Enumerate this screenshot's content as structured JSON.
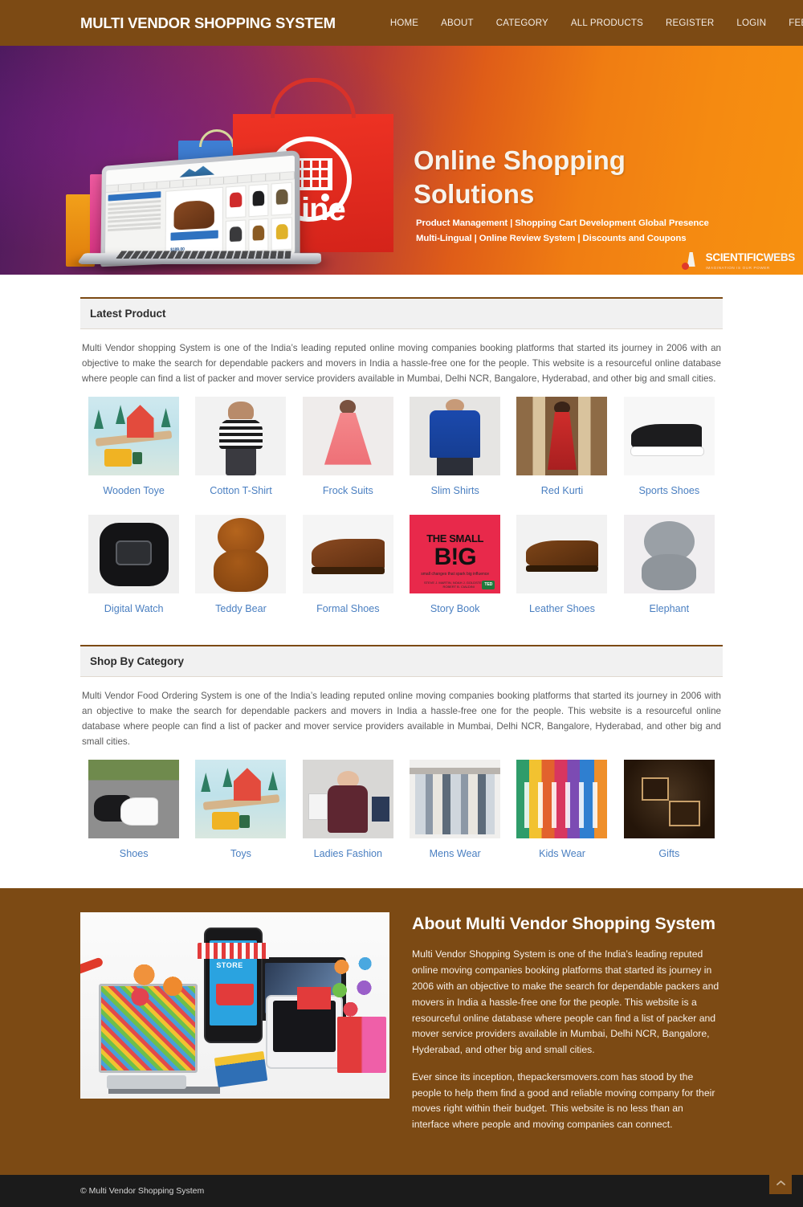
{
  "header": {
    "brand": "MULTI VENDOR SHOPPING SYSTEM",
    "brand_color": "#7c4a14",
    "nav": [
      {
        "label": "HOME",
        "name": "nav-home"
      },
      {
        "label": "ABOUT",
        "name": "nav-about"
      },
      {
        "label": "CATEGORY",
        "name": "nav-category"
      },
      {
        "label": "ALL PRODUCTS",
        "name": "nav-all-products"
      },
      {
        "label": "REGISTER",
        "name": "nav-register"
      },
      {
        "label": "LOGIN",
        "name": "nav-login"
      },
      {
        "label": "FEEDBACK",
        "name": "nav-feedback"
      }
    ]
  },
  "banner": {
    "headline_line1": "Online Shopping",
    "headline_line2": "Solutions",
    "subline1": "Product Management | Shopping Cart Development Global Presence",
    "subline2": "Multi-Lingual  | Online Review System | Discounts and Coupons",
    "bag_word": "online",
    "watermark_main": "SCIENTIFIC",
    "watermark_accent": "WEBS",
    "watermark_tagline": "IMAGINATION IS OUR POWER",
    "laptop_price": "$189.00",
    "laptop_banner_text": "OUR BEST SELLER!"
  },
  "latest_product": {
    "panel_title": "Latest Product",
    "description": "Multi Vendor shopping System is one of the India’s leading reputed online moving companies booking platforms that started its journey in 2006 with an objective to make the search for dependable packers and movers in India a hassle-free one for the people. This website is a resourceful online database where people can find a list of packer and mover service providers available in Mumbai, Delhi NCR, Bangalore, Hyderabad, and other big and small cities.",
    "items": [
      {
        "label": "Wooden Toye",
        "art": "art-train"
      },
      {
        "label": "Cotton T-Shirt",
        "art": "art-tshirt"
      },
      {
        "label": "Frock Suits",
        "art": "art-frock"
      },
      {
        "label": "Slim Shirts",
        "art": "art-slim"
      },
      {
        "label": "Red Kurti",
        "art": "art-kurti"
      },
      {
        "label": "Sports Shoes",
        "art": "art-sports"
      },
      {
        "label": "Digital Watch",
        "art": "art-watch"
      },
      {
        "label": "Teddy Bear",
        "art": "art-teddy"
      },
      {
        "label": "Formal Shoes",
        "art": "art-formal"
      },
      {
        "label": "Story Book",
        "art": "art-book"
      },
      {
        "label": "Leather Shoes",
        "art": "art-leather"
      },
      {
        "label": "Elephant",
        "art": "art-eleph"
      }
    ],
    "book_cover": {
      "title": "THE SMALL",
      "big": "B!G",
      "subtitle": "small changes that spark big influence",
      "authors": "STEVE J. MARTIN, NOAH J. GOLDSTEIN, AND ROBERT B. CIALDINI",
      "badge": "TED"
    }
  },
  "shop_by_category": {
    "panel_title": "Shop By Category",
    "description": "Multi Vendor Food Ordering System is one of the India’s leading reputed online moving companies booking platforms that started its journey in 2006 with an objective to make the search for dependable packers and movers in India a hassle-free one for the people. This website is a resourceful online database where people can find a list of packer and mover service providers available in Mumbai, Delhi NCR, Bangalore, Hyderabad, and other big and small cities.",
    "items": [
      {
        "label": "Shoes",
        "art": "art-cat-shoes"
      },
      {
        "label": "Toys",
        "art": "art-train"
      },
      {
        "label": "Ladies Fashion",
        "art": "art-cat-ladies"
      },
      {
        "label": "Mens Wear",
        "art": "art-cat-mens"
      },
      {
        "label": "Kids Wear",
        "art": "art-cat-kids"
      },
      {
        "label": "Gifts",
        "art": "art-cat-gifts"
      }
    ]
  },
  "about": {
    "title": "About Multi Vendor Shopping System",
    "paragraph1": "Multi Vendor Shopping System is one of the India’s leading reputed online moving companies booking platforms that started its journey in 2006 with an objective to make the search for dependable packers and movers in India a hassle-free one for the people. This website is a resourceful online database where people can find a list of packer and mover service providers available in Mumbai, Delhi NCR, Bangalore, Hyderabad, and other big and small cities.",
    "paragraph2": "Ever since its inception, thepackersmovers.com has stood by the people to help them find a good and reliable moving company for their moves right within their budget. This website is no less than an interface where people and moving companies can connect.",
    "image_caption": "STORE"
  },
  "footer": {
    "copyright": "© Multi Vendor Shopping System",
    "scroll_top_icon": "chevron-up-icon"
  }
}
